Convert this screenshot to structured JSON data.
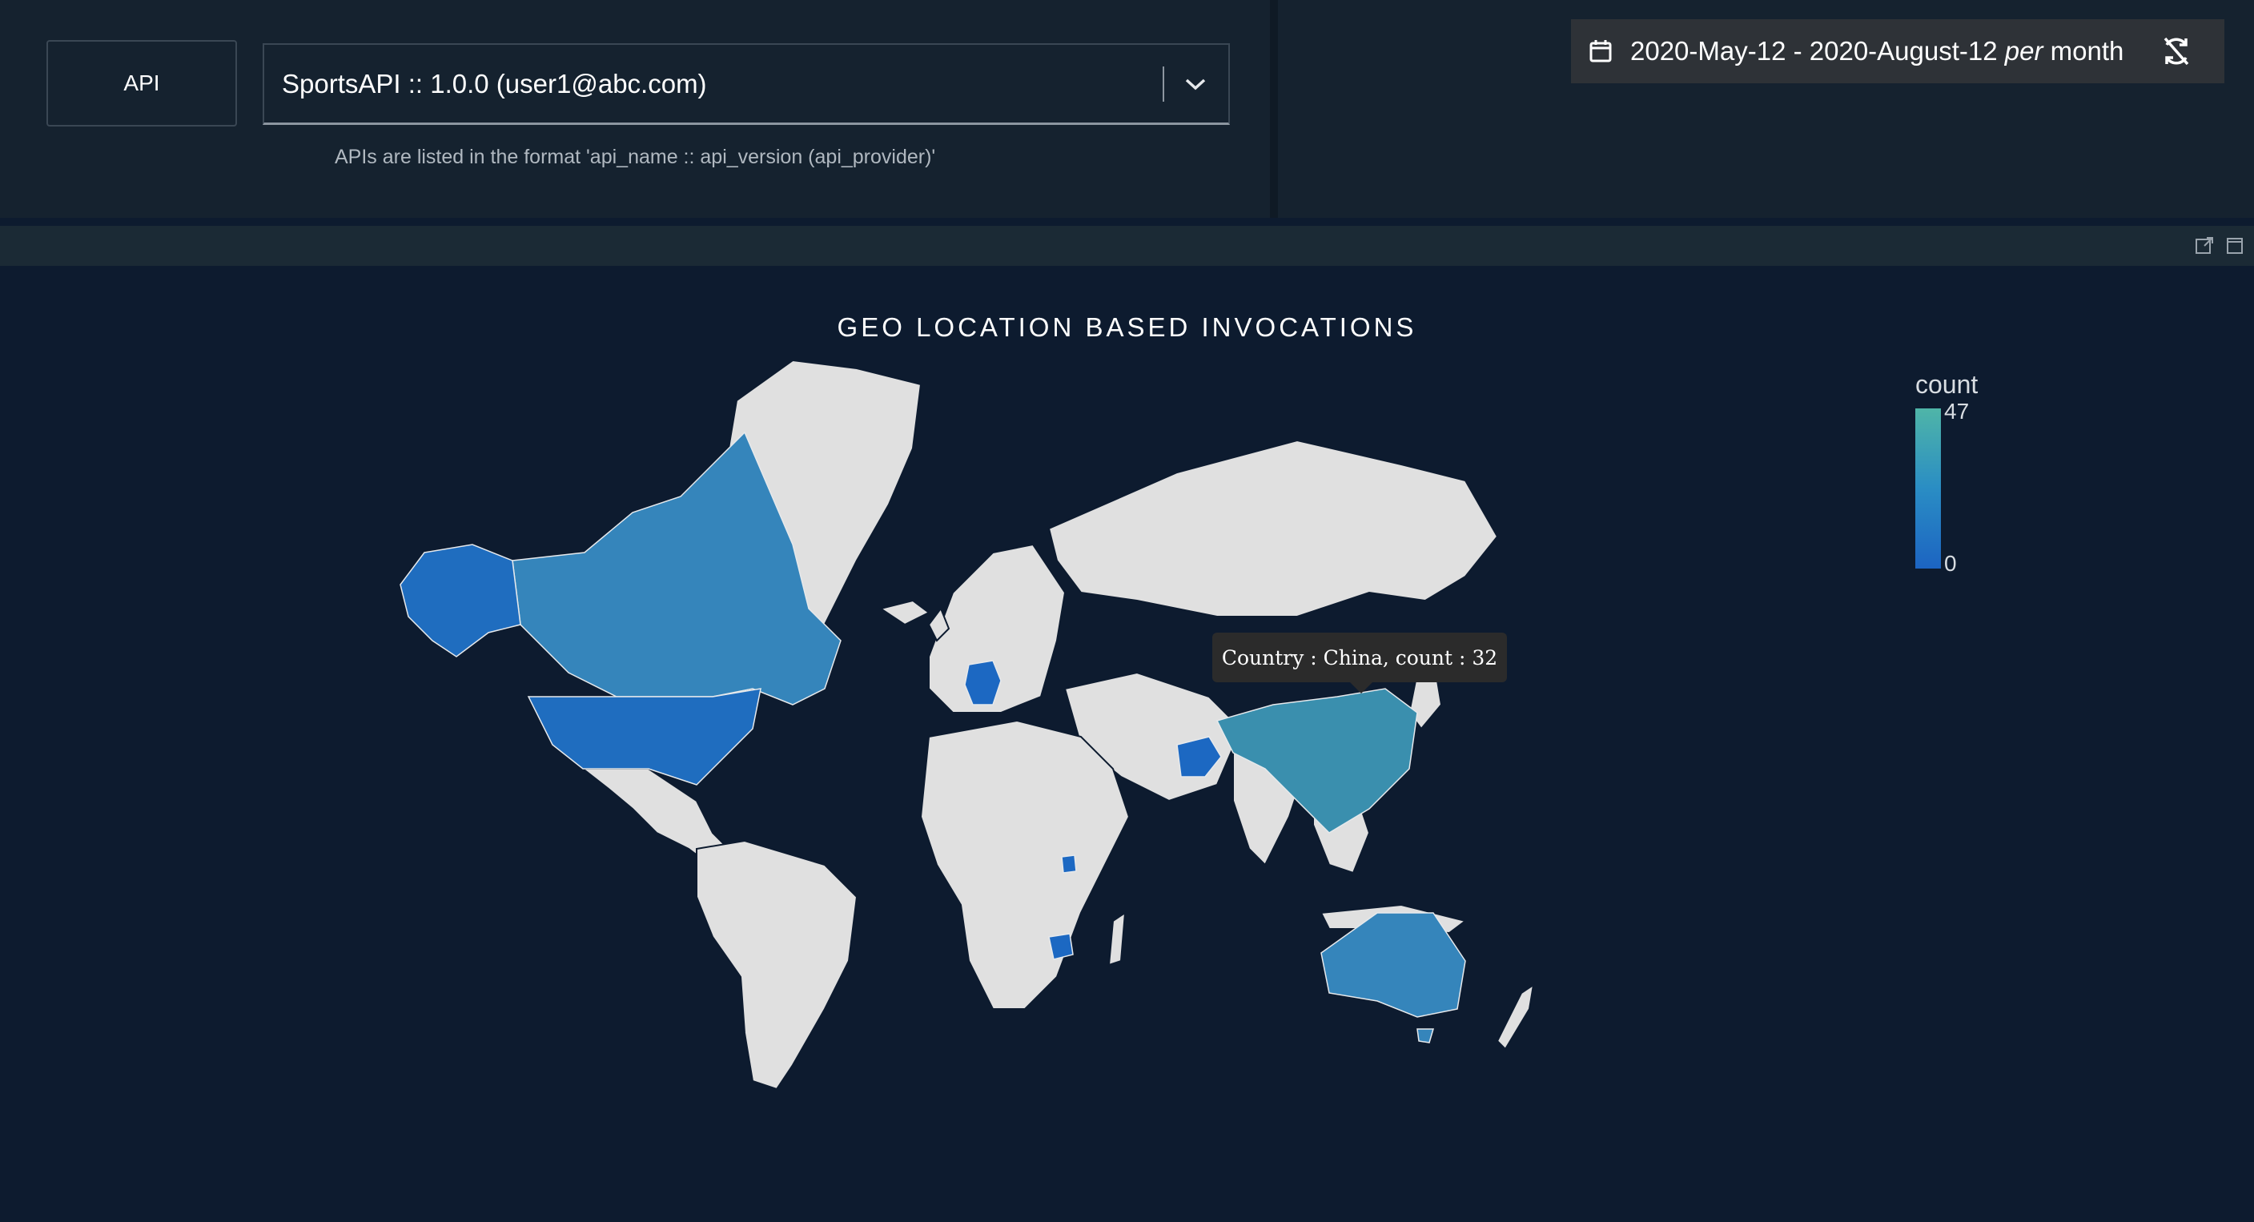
{
  "filter": {
    "api_label": "API",
    "selected_api": "SportsAPI :: 1.0.0 (user1@abc.com)",
    "hint": "APIs are listed in the format 'api_name :: api_version (api_provider)'"
  },
  "date_range": {
    "range": "2020-May-12 - 2020-August-12",
    "per": "per",
    "granularity": "month"
  },
  "colors": {
    "background": "#0d1b2f",
    "panel": "#15222f",
    "land_default": "#e0e0e0",
    "scale_low": "#1c64c2",
    "scale_high": "#4fb5a8"
  },
  "icons": {
    "calendar": "calendar-icon",
    "reset": "sync-disabled-icon",
    "popout": "popout-icon",
    "maximize": "maximize-icon",
    "dropdown": "chevron-down-icon"
  },
  "chart_data": {
    "type": "choropleth",
    "title": "GEO LOCATION BASED INVOCATIONS",
    "legend": {
      "title": "count",
      "max": 47,
      "min": 0,
      "placement": "top-right"
    },
    "tooltip": "Country : China, count : 32",
    "regions": [
      {
        "country": "China",
        "count": 32
      },
      {
        "country": "Canada",
        "count": 28
      },
      {
        "country": "Australia",
        "count": 26
      },
      {
        "country": "United States",
        "count": 10
      },
      {
        "country": "Germany",
        "count": 6
      },
      {
        "country": "Afghanistan",
        "count": 6
      },
      {
        "country": "Zimbabwe",
        "count": 5
      },
      {
        "country": "Uganda",
        "count": 5
      }
    ]
  }
}
